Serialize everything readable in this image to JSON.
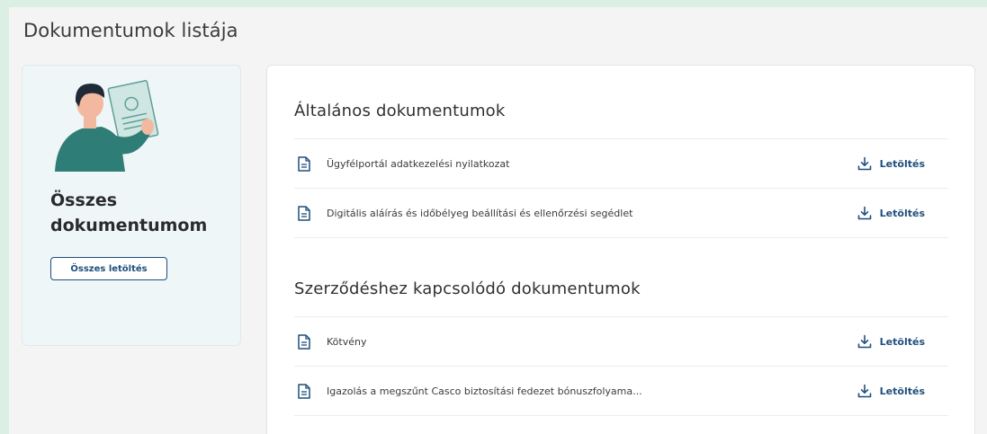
{
  "page": {
    "title": "Dokumentumok listája"
  },
  "side_card": {
    "title_line1": "Összes",
    "title_line2": "dokumentumom",
    "download_all_label": "Összes letöltés"
  },
  "sections": [
    {
      "title": "Általános dokumentumok",
      "documents": [
        {
          "name": "Ügyfélportál adatkezelési nyilatkozat",
          "action": "Letöltés"
        },
        {
          "name": "Digitális aláírás és időbélyeg beállítási és ellenőrzési segédlet",
          "action": "Letöltés"
        }
      ]
    },
    {
      "title": "Szerződéshez kapcsolódó dokumentumok",
      "documents": [
        {
          "name": "Kötvény",
          "action": "Letöltés"
        },
        {
          "name": "Igazolás a megszűnt Casco biztosítási fedezet bónuszfolyama...",
          "action": "Letöltés"
        }
      ]
    }
  ],
  "icons": {
    "document": "document-icon",
    "download": "download-icon",
    "illustration": "person-holding-document-illustration"
  },
  "colors": {
    "background_outer": "#dcefe4",
    "background_page": "#f4f4f4",
    "side_card_bg": "#eef6f8",
    "accent_blue": "#1f4f7d",
    "illustration_teal": "#2e7d76"
  }
}
